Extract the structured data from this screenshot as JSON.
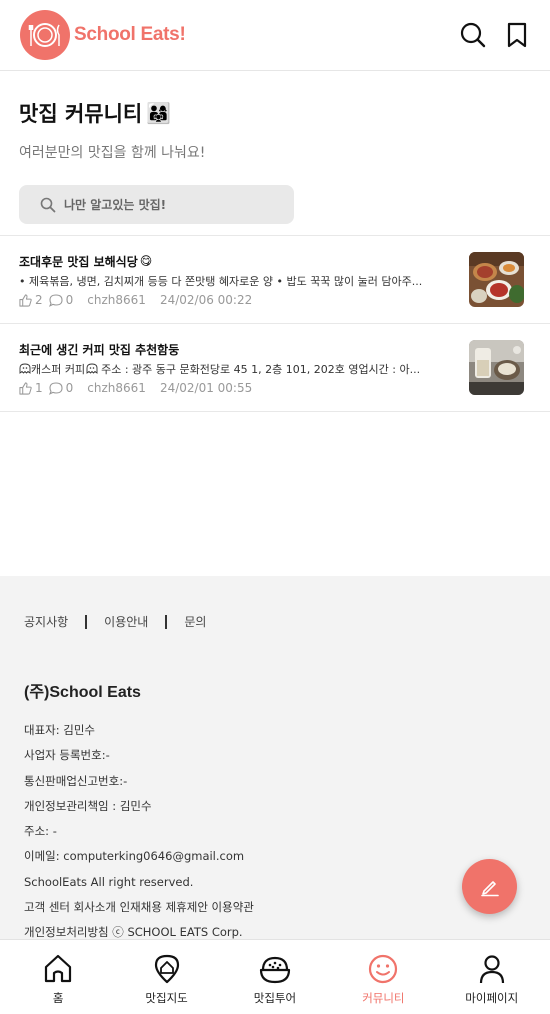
{
  "brand": {
    "name": "School Eats!"
  },
  "page": {
    "title": "맛집 커뮤니티",
    "title_emoji": "👨‍👩‍👧",
    "subtitle": "여러분만의 맛집을 함께 나눠요!"
  },
  "search": {
    "placeholder": "나만 알고있는 맛집!"
  },
  "posts": [
    {
      "title": "조대후문 맛집 보해식당",
      "title_emoji": "😋",
      "summary": "• 제육볶음, 냉면, 김치찌개 등등 다 쫀맛탱 혜자로운 양 • 밥도 꾹꾹 많이 눌러 담아주...",
      "likes": "2",
      "comments": "0",
      "author": "chzh8661",
      "date": "24/02/06 00:22"
    },
    {
      "title": "최근에 생긴 커피 맛집 추천함둥",
      "title_emoji": "",
      "summary_prefix": "캐스퍼 커피",
      "summary": "주소 : 광주 동구 문화전당로 45 1, 2층 101, 202호 영업시간 : 아...",
      "likes": "1",
      "comments": "0",
      "author": "chzh8661",
      "date": "24/02/01 00:55"
    }
  ],
  "footer": {
    "links": [
      "공지사항",
      "이용안내",
      "문의"
    ],
    "company": "(주)School Eats",
    "lines": [
      "대표자: 김민수",
      "사업자 등록번호:-",
      "통신판매업신고번호:-",
      "개인정보관리책임 : 김민수",
      "주소: -",
      "이메일: computerking0646@gmail.com",
      "SchoolEats All right reserved.",
      "고객 센터 회사소개 인재채용 제휴제안 이용약관",
      "개인정보처리방침 ⓒ SCHOOL EATS Corp."
    ]
  },
  "nav": {
    "items": [
      {
        "label": "홈",
        "icon": "home-icon"
      },
      {
        "label": "맛집지도",
        "icon": "map-pin-icon"
      },
      {
        "label": "맛집투어",
        "icon": "rice-bowl-icon"
      },
      {
        "label": "커뮤니티",
        "icon": "smile-icon"
      },
      {
        "label": "마이페이지",
        "icon": "user-icon"
      }
    ],
    "active": "커뮤니티"
  },
  "colors": {
    "accent": "#f0736a",
    "footer_bg": "#f3f3f3",
    "search_bg": "#e9e9e9"
  }
}
